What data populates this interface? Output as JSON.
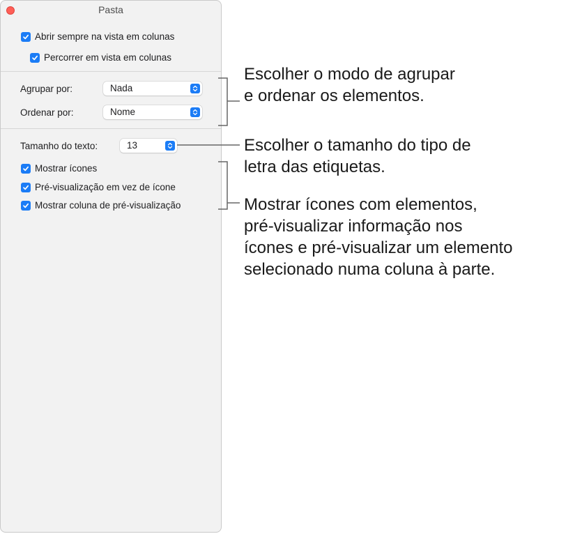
{
  "window": {
    "title": "Pasta"
  },
  "options": {
    "always_open_columns": "Abrir sempre na vista em colunas",
    "browse_columns": "Percorrer em vista em colunas"
  },
  "grouping": {
    "group_label": "Agrupar por:",
    "group_value": "Nada",
    "sort_label": "Ordenar por:",
    "sort_value": "Nome"
  },
  "text": {
    "size_label": "Tamanho do texto:",
    "size_value": "13"
  },
  "display": {
    "show_icons": "Mostrar ícones",
    "preview_icon": "Pré-visualização em vez de ícone",
    "preview_column": "Mostrar coluna de pré-visualização"
  },
  "callouts": {
    "grouping": [
      "Escolher o modo de agrupar",
      "e ordenar os elementos."
    ],
    "text_size": [
      "Escolher o tamanho do tipo de",
      "letra das etiquetas."
    ],
    "icons": [
      "Mostrar ícones com elementos,",
      "pré-visualizar informação nos",
      "ícones e pré-visualizar um elemento",
      "selecionado numa coluna à parte."
    ]
  },
  "colors": {
    "accent": "#1b7cf6",
    "close": "#ff5f57"
  }
}
